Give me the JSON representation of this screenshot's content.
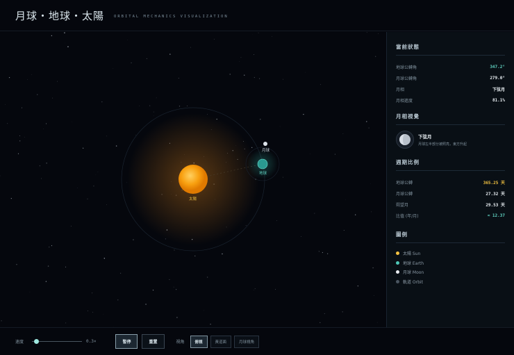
{
  "header": {
    "title": "月球・地球・太陽",
    "subtitle": "ORBITAL MECHANICS VISUALIZATION"
  },
  "scene": {
    "sun_label": "太陽",
    "earth_label": "地球",
    "moon_label": "月球"
  },
  "status": {
    "title": "當前狀態",
    "rows": [
      {
        "label": "地球公轉角",
        "value": "347.2°",
        "color": "#5fd0c0"
      },
      {
        "label": "月球公轉角",
        "value": "279.0°",
        "color": "#e8eef2"
      },
      {
        "label": "月相",
        "value": "下弦月",
        "color": "#e8eef2"
      },
      {
        "label": "月相進度",
        "value": "81.1%",
        "color": "#e8eef2"
      }
    ]
  },
  "phase_view": {
    "title": "月相視覺",
    "name": "下弦月",
    "desc": "月球左半部分被照亮，東方升起"
  },
  "periods": {
    "title": "週期比例",
    "rows": [
      {
        "label": "地球公轉",
        "value": "365.25 天",
        "color": "#f0c040"
      },
      {
        "label": "月球公轉",
        "value": "27.32 天",
        "color": "#e8eef2"
      },
      {
        "label": "朔望月",
        "value": "29.53 天",
        "color": "#e8eef2"
      },
      {
        "label": "比值 (年/月)",
        "value": "≈ 12.37",
        "color": "#5fd0c0"
      }
    ]
  },
  "legend": {
    "title": "圖例",
    "items": [
      {
        "label": "太陽 Sun",
        "color": "#f5c242"
      },
      {
        "label": "地球 Earth",
        "color": "#4fc8b8"
      },
      {
        "label": "月球 Moon",
        "color": "#e8ecf0"
      },
      {
        "label": "軌道 Orbit",
        "color": "#4a5560"
      }
    ]
  },
  "controls": {
    "speed_label": "速度",
    "speed_value": "0.3×",
    "speed_fraction": 0.05,
    "pause": "暫停",
    "reset": "重置",
    "view_label": "視角",
    "views": [
      "俯視",
      "黃道面",
      "月球視角"
    ],
    "active_view": 0
  }
}
